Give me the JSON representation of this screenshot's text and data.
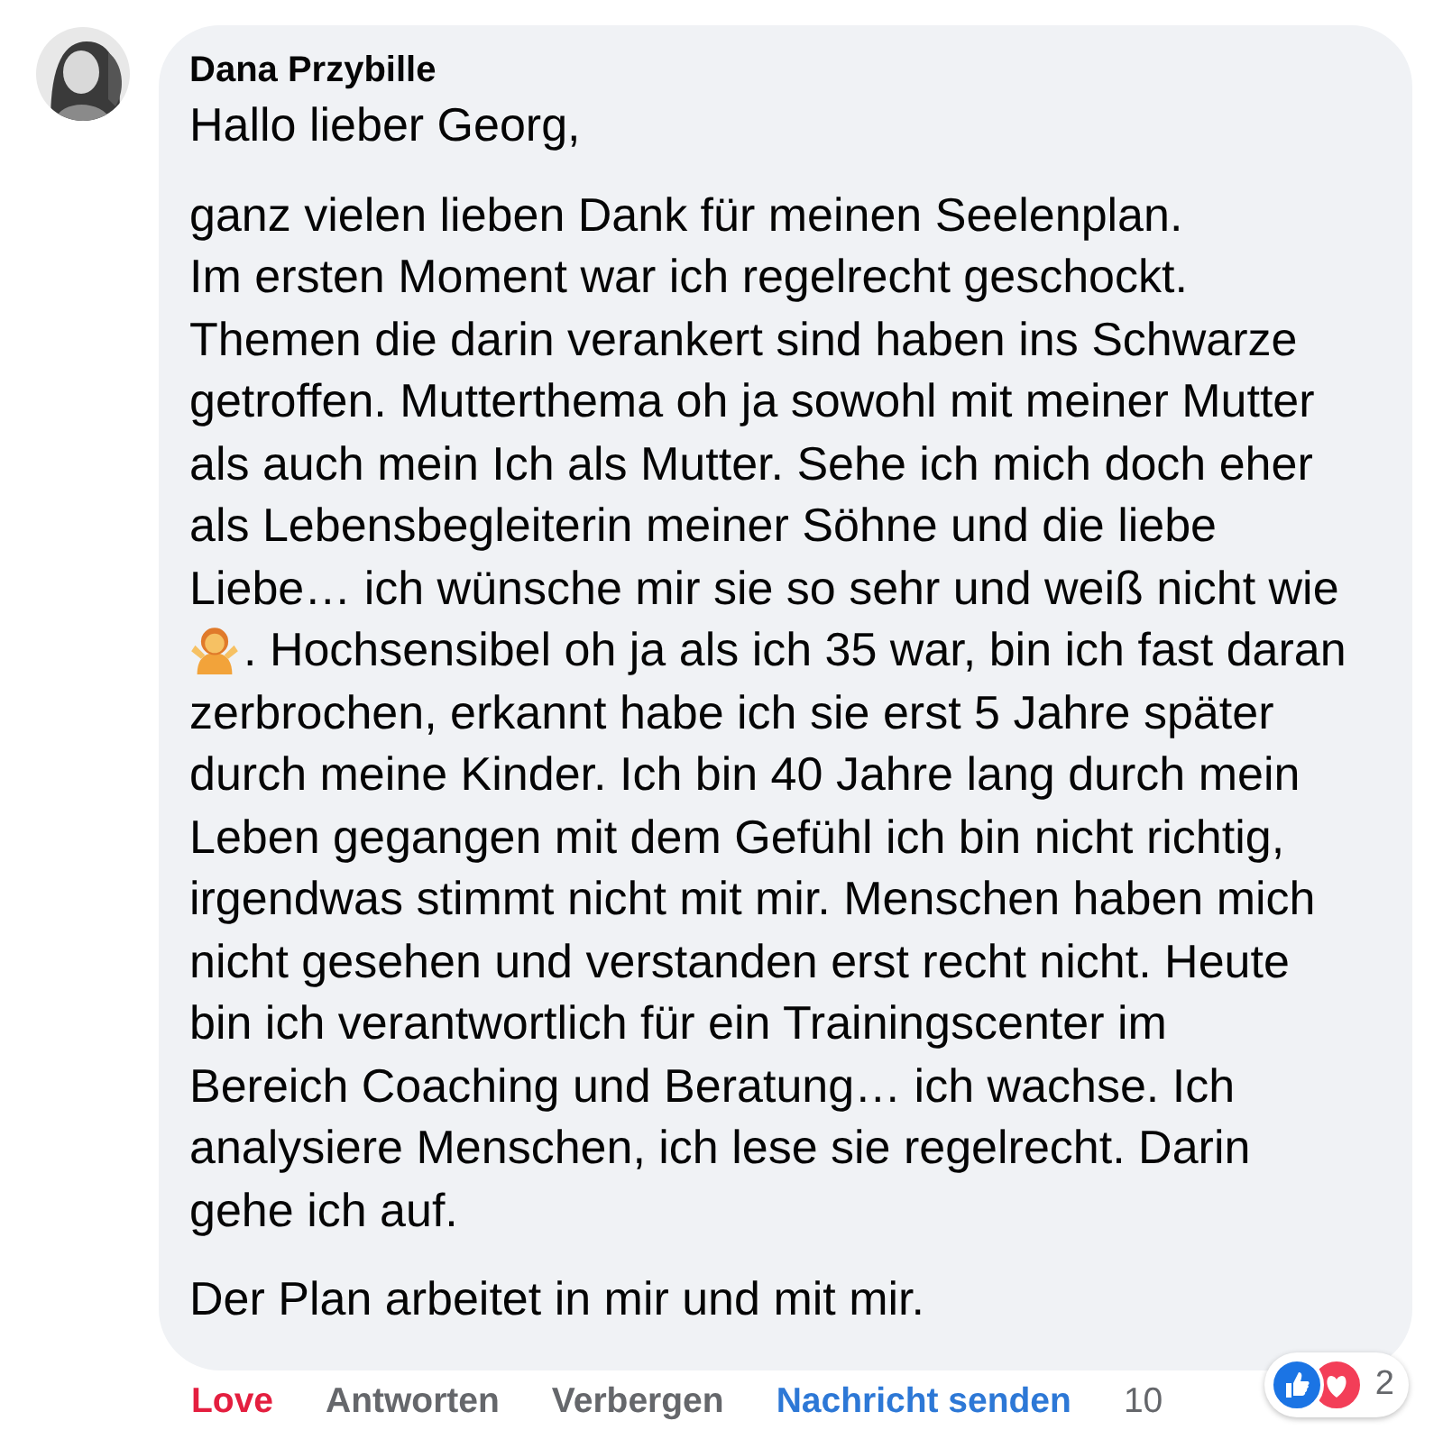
{
  "comment": {
    "author": "Dana Przybille",
    "paragraphs": [
      {
        "lines": [
          {
            "kind": "text",
            "text": "Hallo lieber Georg,"
          }
        ]
      },
      {
        "lines": [
          {
            "kind": "text",
            "text": "ganz vielen lieben Dank für meinen Seelenplan."
          },
          {
            "kind": "text",
            "text": "Im ersten Moment war ich regelrecht geschockt."
          },
          {
            "kind": "text",
            "text": "Themen die darin verankert sind haben ins Schwarze"
          },
          {
            "kind": "text",
            "text": "getroffen. Mutterthema oh ja sowohl mit meiner Mutter"
          },
          {
            "kind": "text",
            "text": "als auch mein Ich als Mutter. Sehe ich mich doch eher"
          },
          {
            "kind": "text",
            "text": "als Lebensbegleiterin meiner Söhne und die liebe"
          },
          {
            "kind": "text",
            "text": "Liebe… ich wünsche mir sie so sehr und weiß nicht wie"
          },
          {
            "kind": "emoji",
            "text": ". Hochsensibel oh ja als ich 35 war, bin ich fast daran"
          },
          {
            "kind": "text",
            "text": "zerbrochen, erkannt habe ich sie erst 5 Jahre später"
          },
          {
            "kind": "text",
            "text": "durch meine Kinder. Ich bin 40 Jahre lang durch mein"
          },
          {
            "kind": "text",
            "text": "Leben gegangen mit dem Gefühl ich bin nicht richtig,"
          },
          {
            "kind": "text",
            "text": "irgendwas stimmt nicht mit mir. Menschen haben mich"
          },
          {
            "kind": "text",
            "text": "nicht gesehen und verstanden erst recht nicht. Heute"
          },
          {
            "kind": "text",
            "text": "bin ich verantwortlich für ein Trainingscenter im"
          },
          {
            "kind": "text",
            "text": "Bereich Coaching und Beratung… ich wachse. Ich"
          },
          {
            "kind": "text",
            "text": "analysiere Menschen, ich lese sie regelrecht. Darin"
          },
          {
            "kind": "text",
            "text": "gehe ich auf."
          }
        ]
      },
      {
        "lines": [
          {
            "kind": "text",
            "text": "Der Plan arbeitet in mir und mit mir."
          }
        ]
      }
    ],
    "actions": [
      {
        "label": "Love",
        "kind": "reaction"
      },
      {
        "label": "Antworten",
        "kind": "action"
      },
      {
        "label": "Verbergen",
        "kind": "action"
      },
      {
        "label": "Nachricht senden",
        "kind": "link"
      }
    ],
    "time": "10",
    "reactions": {
      "count": "2"
    }
  }
}
